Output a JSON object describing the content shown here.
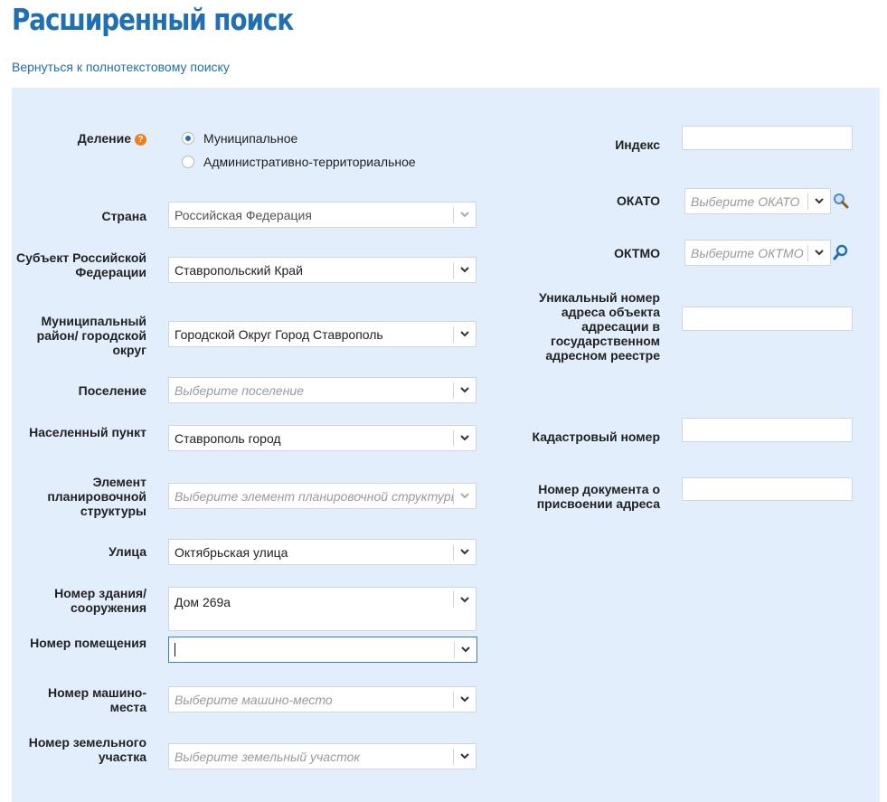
{
  "page": {
    "title": "Расширенный поиск",
    "back_link": "Вернуться к полнотекстовому поиску"
  },
  "colors": {
    "title": "#1f6fb2",
    "panel_bg": "#e2eefb",
    "help_badge": "#f07d1c",
    "radio_dot": "#2a6fb5"
  },
  "division": {
    "label": "Деление",
    "help_icon": "?",
    "options": [
      {
        "label": "Муниципальное",
        "selected": true
      },
      {
        "label": "Административно-территориальное",
        "selected": false
      }
    ]
  },
  "left_fields": {
    "country": {
      "label": "Страна",
      "value": "Российская Федерация"
    },
    "subject": {
      "label": "Субъект Российской Федерации",
      "value": "Ставропольский Край"
    },
    "municipal_district": {
      "label": "Муниципальный район/ городской округ",
      "value": "Городской Округ Город Ставрополь"
    },
    "settlement": {
      "label": "Поселение",
      "placeholder": "Выберите поселение"
    },
    "locality": {
      "label": "Населенный пункт",
      "value": "Ставрополь город"
    },
    "planning_element": {
      "label": "Элемент планировочной структуры",
      "placeholder": "Выберите элемент планировочной структуры"
    },
    "street": {
      "label": "Улица",
      "value": "Октябрьская улица"
    },
    "building": {
      "label": "Номер здания/ сооружения",
      "value": "Дом 269а"
    },
    "room": {
      "label": "Номер помещения",
      "value": ""
    },
    "parking": {
      "label": "Номер машино-места",
      "placeholder": "Выберите машино-место"
    },
    "land_plot": {
      "label": "Номер земельного участка",
      "placeholder": "Выберите земельный участок"
    }
  },
  "right_fields": {
    "index": {
      "label": "Индекс",
      "value": ""
    },
    "okato": {
      "label": "ОКАТО",
      "placeholder": "Выберите ОКАТО"
    },
    "oktmo": {
      "label": "ОКТМО",
      "placeholder": "Выберите ОКТМО"
    },
    "unique_number": {
      "label": "Уникальный номер адреса объекта адресации в государственном адресном реестре",
      "value": ""
    },
    "cadastral": {
      "label": "Кадастровый номер",
      "value": ""
    },
    "document_number": {
      "label": "Номер документа о присвоении адреса",
      "value": ""
    }
  },
  "icons": {
    "dropdown": "chevron-down-icon",
    "okato_picker": "magnifier-icon",
    "oktmo_picker": "search-icon",
    "help": "question-icon"
  }
}
